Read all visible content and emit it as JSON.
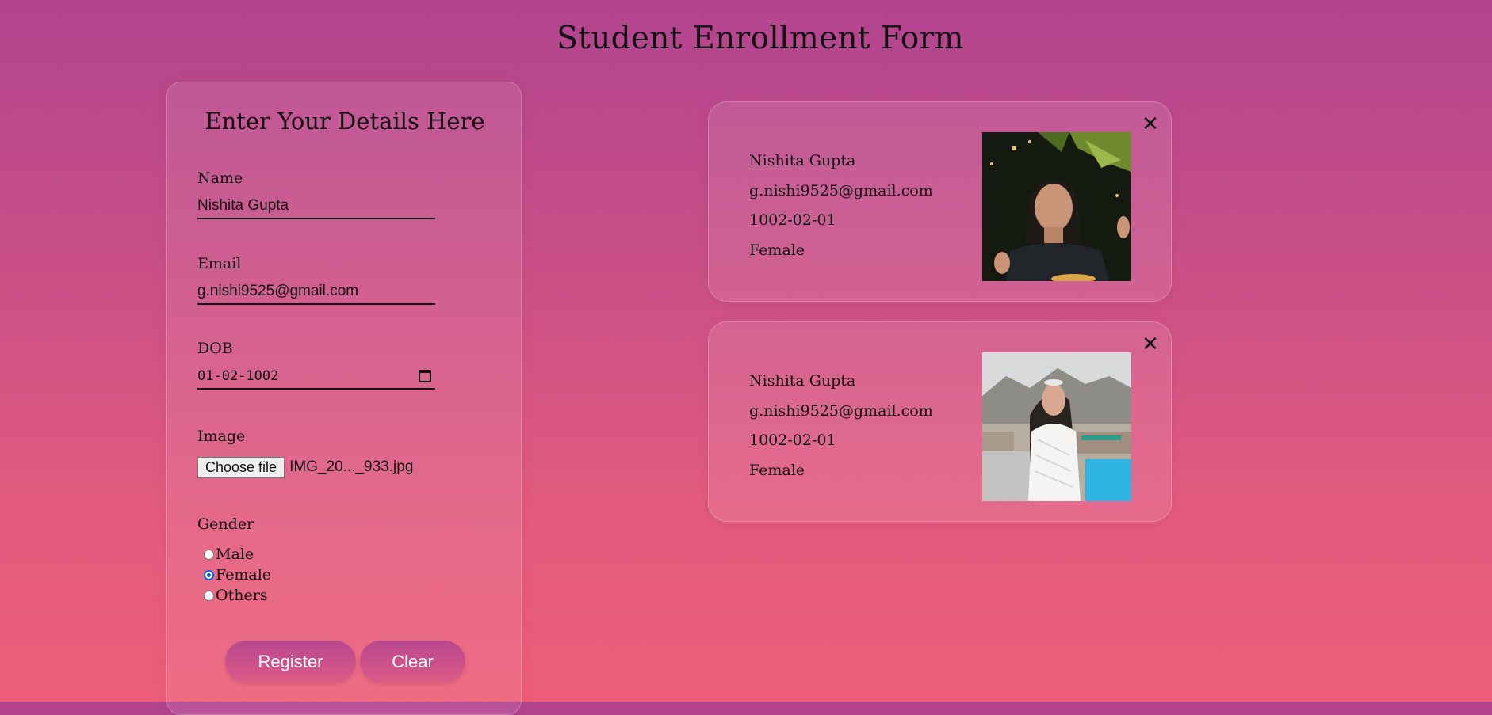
{
  "page": {
    "title": "Student Enrollment Form"
  },
  "form": {
    "heading": "Enter Your Details Here",
    "name_label": "Name",
    "name_value": "Nishita Gupta",
    "email_label": "Email",
    "email_value": "g.nishi9525@gmail.com",
    "dob_label": "DOB",
    "dob_value": "01-02-1002",
    "image_label": "Image",
    "file_button_label": "Choose file",
    "file_name": "IMG_20..._933.jpg",
    "gender_label": "Gender",
    "gender_options": [
      {
        "label": "Male",
        "checked": false
      },
      {
        "label": "Female",
        "checked": true
      },
      {
        "label": "Others",
        "checked": false
      }
    ],
    "register_label": "Register",
    "clear_label": "Clear"
  },
  "records": [
    {
      "name": "Nishita Gupta",
      "email": "g.nishi9525@gmail.com",
      "dob": "1002-02-01",
      "gender": "Female",
      "close_label": "✕"
    },
    {
      "name": "Nishita Gupta",
      "email": "g.nishi9525@gmail.com",
      "dob": "1002-02-01",
      "gender": "Female",
      "close_label": "✕"
    }
  ],
  "colors": {
    "accent": "#0a63d6",
    "button_top": "#b8478f",
    "button_bottom": "#dd5a86"
  },
  "icons": {
    "calendar": "calendar-icon",
    "close": "close-icon"
  }
}
